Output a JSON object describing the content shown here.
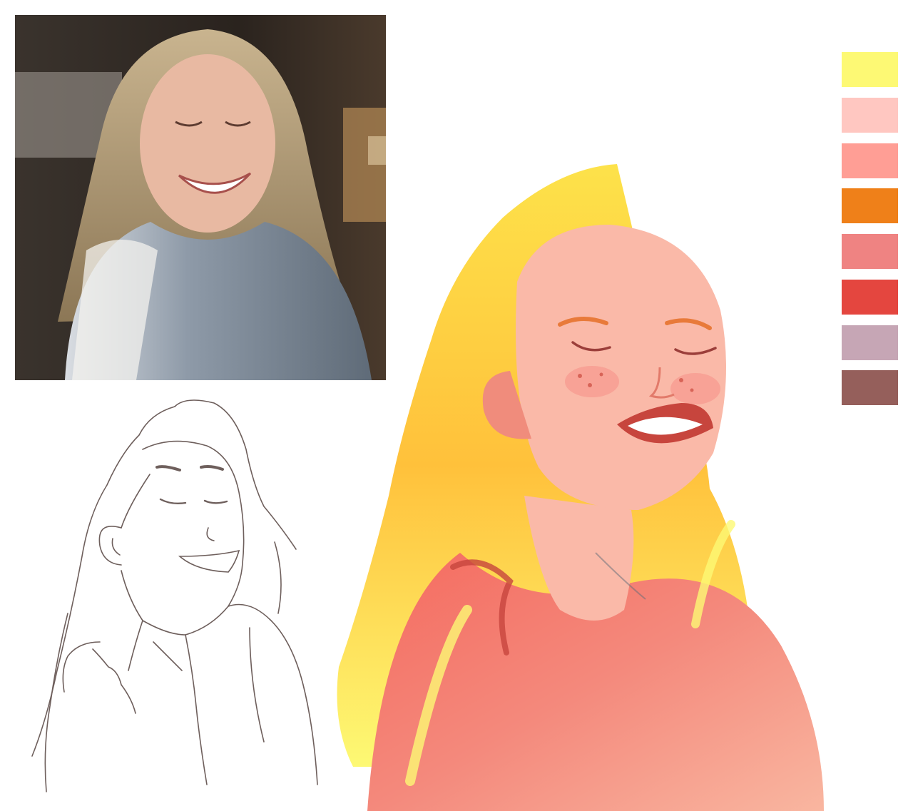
{
  "palette": {
    "swatches": [
      {
        "name": "swatch-yellow",
        "color": "#FDF974"
      },
      {
        "name": "swatch-light-pink",
        "color": "#FFC7C1"
      },
      {
        "name": "swatch-salmon",
        "color": "#FF9E95"
      },
      {
        "name": "swatch-orange",
        "color": "#EF8019"
      },
      {
        "name": "swatch-coral",
        "color": "#EF8382"
      },
      {
        "name": "swatch-red",
        "color": "#E4463F"
      },
      {
        "name": "swatch-mauve",
        "color": "#C6A6B5"
      },
      {
        "name": "swatch-brown",
        "color": "#955F5B"
      }
    ]
  },
  "colors": {
    "background": "#FFFFFF",
    "sketch_line": "#6E5F5C",
    "hair_yellow": "#FDE24A",
    "skin": "#FAB9A8",
    "shirt": "#F07A6E"
  }
}
